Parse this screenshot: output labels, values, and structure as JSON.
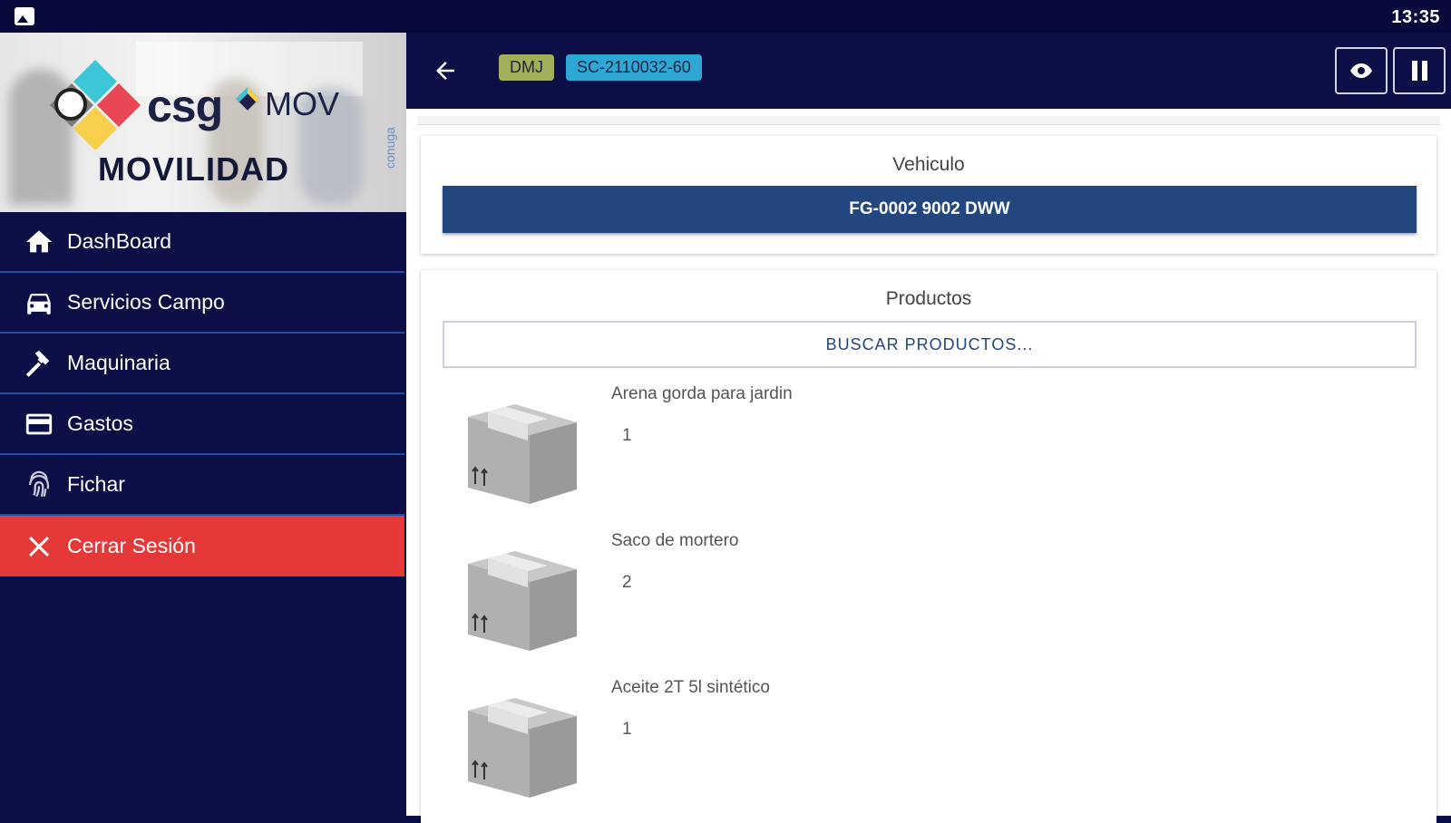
{
  "status_bar": {
    "time": "13:35"
  },
  "brand": {
    "logo_csg": "csg",
    "logo_mov": "MOV",
    "logo_movilidad": "MOVILIDAD",
    "logo_side": "conuga"
  },
  "nav": {
    "items": [
      {
        "label": "DashBoard",
        "icon": "home-icon"
      },
      {
        "label": "Servicios Campo",
        "icon": "car-icon"
      },
      {
        "label": "Maquinaria",
        "icon": "hammer-icon"
      },
      {
        "label": "Gastos",
        "icon": "credit-card-icon"
      },
      {
        "label": "Fichar",
        "icon": "fingerprint-icon"
      },
      {
        "label": "Cerrar Sesión",
        "icon": "close-icon"
      }
    ]
  },
  "header": {
    "chip_dmj": "DMJ",
    "chip_code": "SC-2110032-60"
  },
  "vehicle": {
    "title": "Vehiculo",
    "plate": "FG-0002 9002 DWW"
  },
  "products": {
    "title": "Productos",
    "search_label": "BUSCAR PRODUCTOS...",
    "items": [
      {
        "name": "Arena gorda para jardin",
        "qty": "1"
      },
      {
        "name": "Saco de mortero",
        "qty": "2"
      },
      {
        "name": "Aceite 2T 5l sintético",
        "qty": "1"
      }
    ]
  },
  "colors": {
    "navy": "#0b0f45",
    "logout_red": "#e53838",
    "plate_blue": "#22477f",
    "chip_olive": "#a3b05a",
    "chip_cyan": "#2fa7d4"
  }
}
